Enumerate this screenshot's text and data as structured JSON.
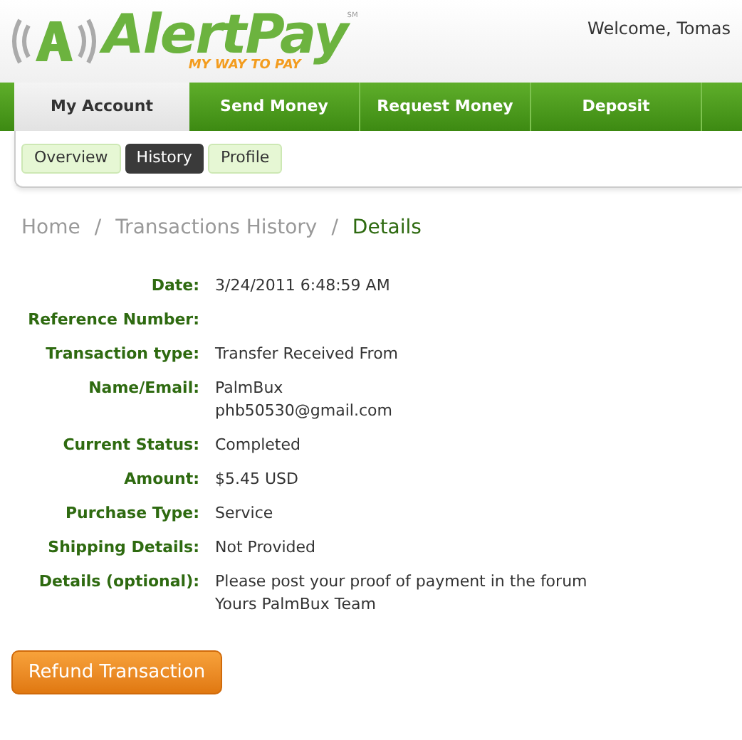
{
  "header": {
    "logo": {
      "name": "AlertPay",
      "tagline": "MY WAY TO PAY",
      "mark": "SM"
    },
    "welcome": "Welcome, Tomas"
  },
  "nav_tabs": [
    {
      "label": "My Account",
      "selected": true
    },
    {
      "label": "Send Money",
      "selected": false
    },
    {
      "label": "Request Money",
      "selected": false
    },
    {
      "label": "Deposit",
      "selected": false
    }
  ],
  "sub_tabs": [
    {
      "label": "Overview",
      "selected": false
    },
    {
      "label": "History",
      "selected": true
    },
    {
      "label": "Profile",
      "selected": false
    }
  ],
  "breadcrumb": {
    "separator": "/",
    "items": [
      {
        "label": "Home",
        "current": false
      },
      {
        "label": "Transactions History",
        "current": false
      },
      {
        "label": "Details",
        "current": true
      }
    ]
  },
  "details": [
    {
      "label": "Date:",
      "value": [
        "3/24/2011 6:48:59 AM"
      ]
    },
    {
      "label": "Reference Number:"
    },
    {
      "label": "Transaction type:",
      "value": [
        "Transfer Received From"
      ]
    },
    {
      "label": "Name/Email:",
      "value": [
        "PalmBux",
        "phb50530@gmail.com"
      ]
    },
    {
      "label": "Current Status:",
      "value": [
        "Completed"
      ]
    },
    {
      "label": "Amount:",
      "value": [
        "$5.45 USD"
      ]
    },
    {
      "label": "Purchase Type:",
      "value": [
        "Service"
      ]
    },
    {
      "label": "Shipping Details:",
      "value": [
        "Not Provided"
      ]
    },
    {
      "label": "Details (optional):",
      "value": [
        "Please post your proof of payment in the forum",
        "Yours PalmBux Team"
      ]
    }
  ],
  "refund_button": "Refund Transaction"
}
